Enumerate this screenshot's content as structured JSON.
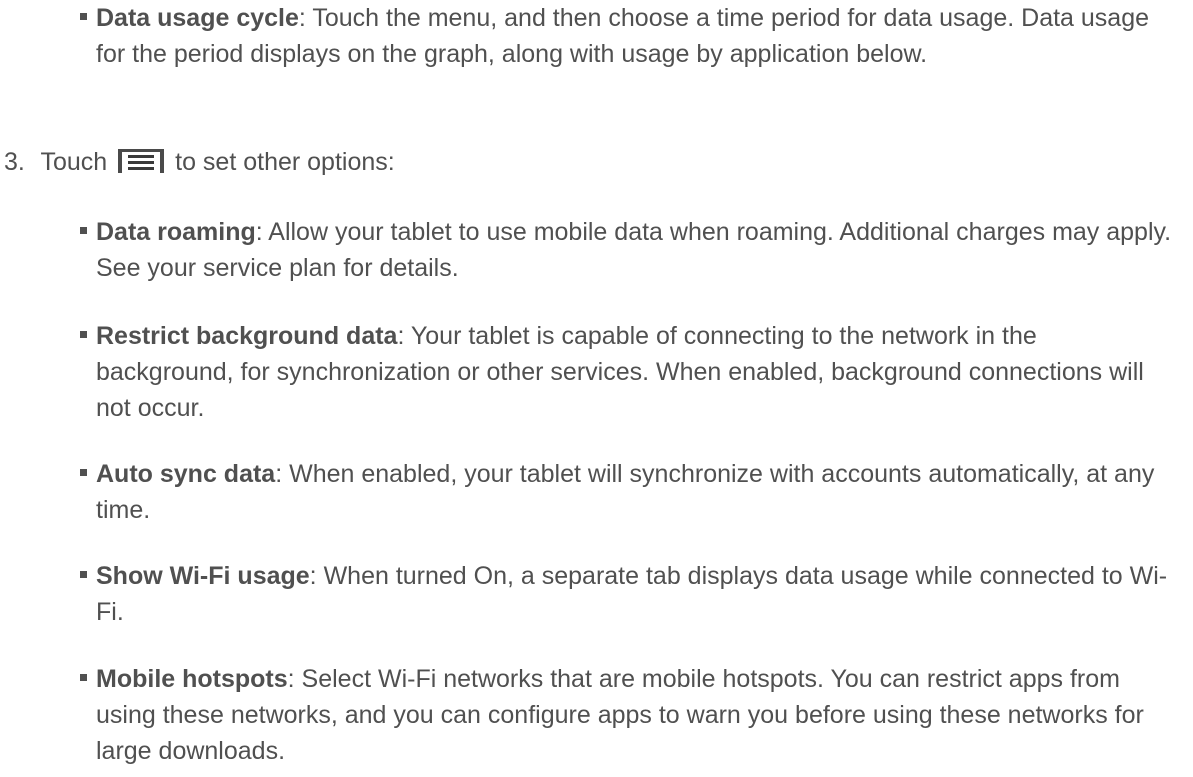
{
  "items": [
    {
      "term": "Data usage cycle",
      "desc": ": Touch the menu, and then choose a time period for data usage. Data usage for the period displays on the graph, along with usage by application below."
    }
  ],
  "step3": {
    "number": "3.",
    "before_icon": "Touch",
    "after_icon": "to set other options:",
    "icon": "menu-icon"
  },
  "options": [
    {
      "term": "Data roaming",
      "desc": ": Allow your tablet to use mobile data when roaming. Additional charges may apply. See your service plan for details."
    },
    {
      "term": "Restrict background data",
      "desc": ": Your tablet is capable of connecting to the network in the background, for synchronization or other services. When enabled, background connections will not occur."
    },
    {
      "term": "Auto sync data",
      "desc": ": When enabled, your tablet will synchronize with accounts automatically, at any time."
    },
    {
      "term": "Show Wi-Fi usage",
      "desc": ": When turned On, a separate tab displays data usage while connected to Wi-Fi."
    },
    {
      "term": "Mobile hotspots",
      "desc": ": Select Wi-Fi networks that are mobile hotspots. You can restrict apps from using these networks, and you can configure apps to warn you before using these networks for large downloads."
    }
  ]
}
